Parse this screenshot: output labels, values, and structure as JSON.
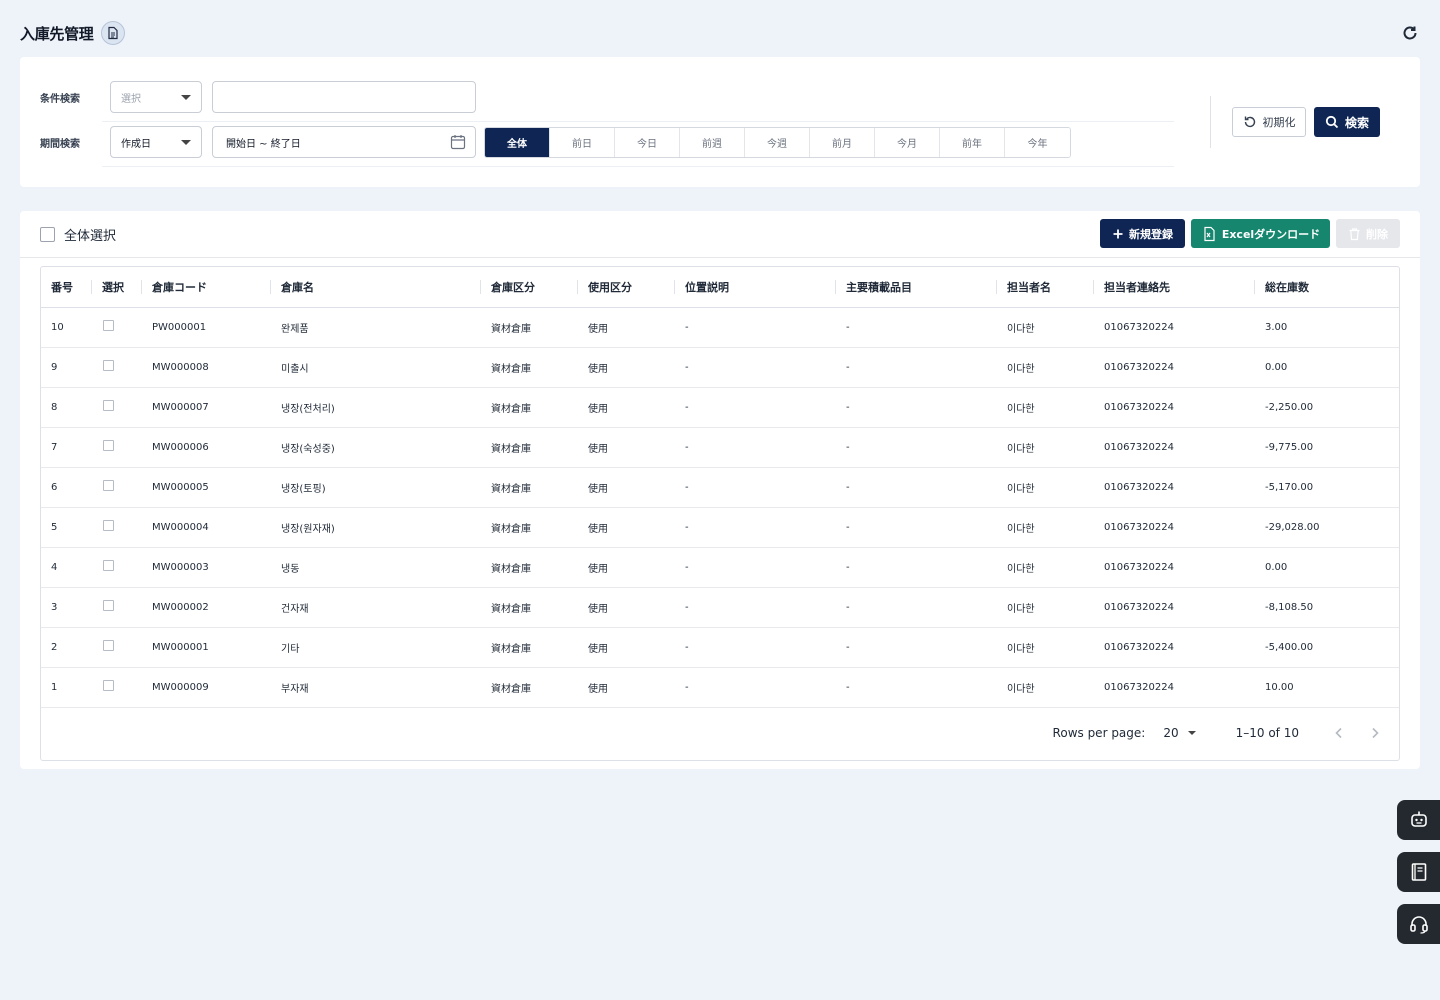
{
  "header": {
    "title": "入庫先管理"
  },
  "search": {
    "condition_label": "条件検索",
    "condition_select": "選択",
    "keyword_value": "",
    "period_label": "期間検索",
    "period_select": "作成日",
    "date_range": "開始日 ~ 終了日",
    "period_buttons": [
      "全体",
      "前日",
      "今日",
      "前週",
      "今週",
      "前月",
      "今月",
      "前年",
      "今年"
    ],
    "period_active": "全体",
    "reset_label": "初期化",
    "search_label": "検索"
  },
  "toolbar": {
    "select_all_label": "全体選択",
    "new_label": "新規登録",
    "excel_label": "Excelダウンロード",
    "delete_label": "削除"
  },
  "table": {
    "columns": [
      "番号",
      "選択",
      "倉庫コード",
      "倉庫名",
      "倉庫区分",
      "使用区分",
      "位置説明",
      "主要積載品目",
      "担当者名",
      "担当者連絡先",
      "総在庫数"
    ],
    "rows": [
      {
        "no": "10",
        "code": "PW000001",
        "name": "완제품",
        "type": "資材倉庫",
        "usage": "使用",
        "location": "-",
        "items": "-",
        "manager": "이다한",
        "contact": "01067320224",
        "stock": "3.00"
      },
      {
        "no": "9",
        "code": "MW000008",
        "name": "미출시",
        "type": "資材倉庫",
        "usage": "使用",
        "location": "-",
        "items": "-",
        "manager": "이다한",
        "contact": "01067320224",
        "stock": "0.00"
      },
      {
        "no": "8",
        "code": "MW000007",
        "name": "냉장(전처리)",
        "type": "資材倉庫",
        "usage": "使用",
        "location": "-",
        "items": "-",
        "manager": "이다한",
        "contact": "01067320224",
        "stock": "-2,250.00"
      },
      {
        "no": "7",
        "code": "MW000006",
        "name": "냉장(숙성중)",
        "type": "資材倉庫",
        "usage": "使用",
        "location": "-",
        "items": "-",
        "manager": "이다한",
        "contact": "01067320224",
        "stock": "-9,775.00"
      },
      {
        "no": "6",
        "code": "MW000005",
        "name": "냉장(토핑)",
        "type": "資材倉庫",
        "usage": "使用",
        "location": "-",
        "items": "-",
        "manager": "이다한",
        "contact": "01067320224",
        "stock": "-5,170.00"
      },
      {
        "no": "5",
        "code": "MW000004",
        "name": "냉장(원자재)",
        "type": "資材倉庫",
        "usage": "使用",
        "location": "-",
        "items": "-",
        "manager": "이다한",
        "contact": "01067320224",
        "stock": "-29,028.00"
      },
      {
        "no": "4",
        "code": "MW000003",
        "name": "냉동",
        "type": "資材倉庫",
        "usage": "使用",
        "location": "-",
        "items": "-",
        "manager": "이다한",
        "contact": "01067320224",
        "stock": "0.00"
      },
      {
        "no": "3",
        "code": "MW000002",
        "name": "건자재",
        "type": "資材倉庫",
        "usage": "使用",
        "location": "-",
        "items": "-",
        "manager": "이다한",
        "contact": "01067320224",
        "stock": "-8,108.50"
      },
      {
        "no": "2",
        "code": "MW000001",
        "name": "기타",
        "type": "資材倉庫",
        "usage": "使用",
        "location": "-",
        "items": "-",
        "manager": "이다한",
        "contact": "01067320224",
        "stock": "-5,400.00"
      },
      {
        "no": "1",
        "code": "MW000009",
        "name": "부자재",
        "type": "資材倉庫",
        "usage": "使用",
        "location": "-",
        "items": "-",
        "manager": "이다한",
        "contact": "01067320224",
        "stock": "10.00"
      }
    ]
  },
  "pagination": {
    "rows_per_page_label": "Rows per page:",
    "rows_per_page": "20",
    "range": "1–10 of 10"
  },
  "colors": {
    "primary": "#0f2654",
    "excel": "#16866f",
    "background": "#eef3fa",
    "floating": "#24292f"
  },
  "icons": [
    "document-icon",
    "refresh-icon",
    "calendar-icon",
    "reset-icon",
    "search-icon",
    "plus-icon",
    "excel-icon",
    "trash-icon",
    "chevron-left-icon",
    "chevron-right-icon",
    "chatbot-icon",
    "book-icon",
    "headset-icon"
  ]
}
